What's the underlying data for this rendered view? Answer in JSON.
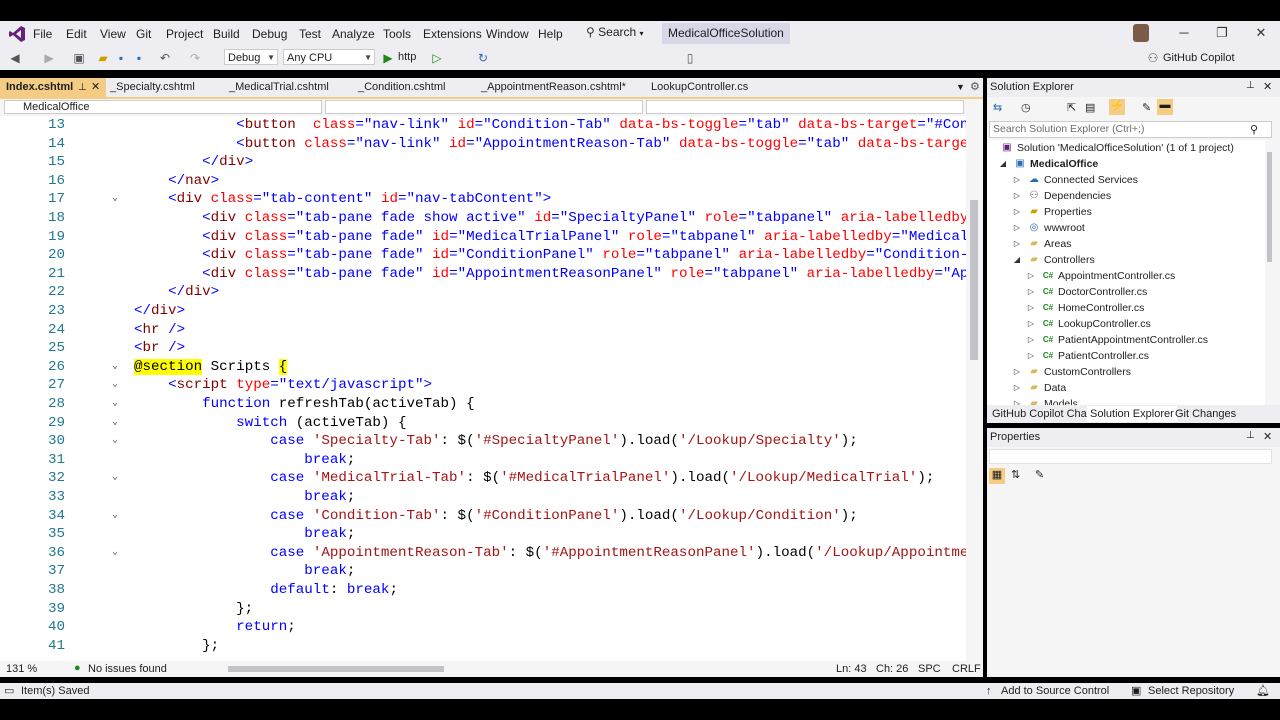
{
  "menu": [
    "File",
    "Edit",
    "View",
    "Git",
    "Project",
    "Build",
    "Debug",
    "Test",
    "Analyze",
    "Tools",
    "Extensions",
    "Window",
    "Help"
  ],
  "search_label": "Search",
  "solution_title": "MedicalOfficeSolution",
  "copilot_label": "GitHub Copilot",
  "toolbar": {
    "config": "Debug",
    "platform": "Any CPU",
    "run_target": "http"
  },
  "doc_tabs": [
    "Index.cshtml",
    "_Specialty.cshtml",
    "_MedicalTrial.cshtml",
    "_Condition.cshtml",
    "_AppointmentReason.cshtml*",
    "LookupController.cs"
  ],
  "nav_project": "MedicalOffice",
  "code_lines": [
    {
      "n": "13",
      "fold": "",
      "seg": [
        [
          "",
          "            "
        ],
        [
          "t-br",
          "<"
        ],
        [
          "t-tag",
          "button"
        ],
        [
          "",
          "  "
        ],
        [
          "t-attr",
          "class"
        ],
        [
          "t-br",
          "="
        ],
        [
          "t-val",
          "\"nav-link\""
        ],
        [
          "",
          " "
        ],
        [
          "t-attr",
          "id"
        ],
        [
          "t-br",
          "="
        ],
        [
          "t-val",
          "\"Condition-Tab\""
        ],
        [
          "",
          " "
        ],
        [
          "t-attr",
          "data-bs-toggle"
        ],
        [
          "t-br",
          "="
        ],
        [
          "t-val",
          "\"tab\""
        ],
        [
          "",
          " "
        ],
        [
          "t-attr",
          "data-bs-target"
        ],
        [
          "t-br",
          "="
        ],
        [
          "t-val",
          "\"#Condit"
        ]
      ]
    },
    {
      "n": "14",
      "fold": "",
      "seg": [
        [
          "",
          "            "
        ],
        [
          "t-br",
          "<"
        ],
        [
          "t-tag",
          "button"
        ],
        [
          "",
          " "
        ],
        [
          "t-attr",
          "class"
        ],
        [
          "t-br",
          "="
        ],
        [
          "t-val",
          "\"nav-link\""
        ],
        [
          "",
          " "
        ],
        [
          "t-attr",
          "id"
        ],
        [
          "t-br",
          "="
        ],
        [
          "t-val",
          "\"AppointmentReason-Tab\""
        ],
        [
          "",
          " "
        ],
        [
          "t-attr",
          "data-bs-toggle"
        ],
        [
          "t-br",
          "="
        ],
        [
          "t-val",
          "\"tab\""
        ],
        [
          "",
          " "
        ],
        [
          "t-attr",
          "data-bs-target"
        ],
        [
          "t-br",
          "="
        ]
      ]
    },
    {
      "n": "15",
      "fold": "",
      "seg": [
        [
          "",
          "        "
        ],
        [
          "t-br",
          "</"
        ],
        [
          "t-tag",
          "div"
        ],
        [
          "t-br",
          ">"
        ]
      ]
    },
    {
      "n": "16",
      "fold": "",
      "seg": [
        [
          "",
          "    "
        ],
        [
          "t-br",
          "</"
        ],
        [
          "t-tag",
          "nav"
        ],
        [
          "t-br",
          ">"
        ]
      ]
    },
    {
      "n": "17",
      "fold": "⌄",
      "seg": [
        [
          "",
          "    "
        ],
        [
          "t-br",
          "<"
        ],
        [
          "t-tag",
          "div"
        ],
        [
          "",
          " "
        ],
        [
          "t-attr",
          "class"
        ],
        [
          "t-br",
          "="
        ],
        [
          "t-val",
          "\"tab-content\""
        ],
        [
          "",
          " "
        ],
        [
          "t-attr",
          "id"
        ],
        [
          "t-br",
          "="
        ],
        [
          "t-val",
          "\"nav-tabContent\""
        ],
        [
          "t-br",
          ">"
        ]
      ]
    },
    {
      "n": "18",
      "fold": "",
      "seg": [
        [
          "",
          "        "
        ],
        [
          "t-br",
          "<"
        ],
        [
          "t-tag",
          "div"
        ],
        [
          "",
          " "
        ],
        [
          "t-attr",
          "class"
        ],
        [
          "t-br",
          "="
        ],
        [
          "t-val",
          "\"tab-pane fade show active\""
        ],
        [
          "",
          " "
        ],
        [
          "t-attr",
          "id"
        ],
        [
          "t-br",
          "="
        ],
        [
          "t-val",
          "\"SpecialtyPanel\""
        ],
        [
          "",
          " "
        ],
        [
          "t-attr",
          "role"
        ],
        [
          "t-br",
          "="
        ],
        [
          "t-val",
          "\"tabpanel\""
        ],
        [
          "",
          " "
        ],
        [
          "t-attr",
          "aria-labelledby"
        ],
        [
          "t-br",
          "="
        ],
        [
          "t-val",
          "\""
        ]
      ]
    },
    {
      "n": "19",
      "fold": "",
      "seg": [
        [
          "",
          "        "
        ],
        [
          "t-br",
          "<"
        ],
        [
          "t-tag",
          "div"
        ],
        [
          "",
          " "
        ],
        [
          "t-attr",
          "class"
        ],
        [
          "t-br",
          "="
        ],
        [
          "t-val",
          "\"tab-pane fade\""
        ],
        [
          "",
          " "
        ],
        [
          "t-attr",
          "id"
        ],
        [
          "t-br",
          "="
        ],
        [
          "t-val",
          "\"MedicalTrialPanel\""
        ],
        [
          "",
          " "
        ],
        [
          "t-attr",
          "role"
        ],
        [
          "t-br",
          "="
        ],
        [
          "t-val",
          "\"tabpanel\""
        ],
        [
          "",
          " "
        ],
        [
          "t-attr",
          "aria-labelledby"
        ],
        [
          "t-br",
          "="
        ],
        [
          "t-val",
          "\"MedicalTr"
        ]
      ]
    },
    {
      "n": "20",
      "fold": "",
      "seg": [
        [
          "",
          "        "
        ],
        [
          "t-br",
          "<"
        ],
        [
          "t-tag",
          "div"
        ],
        [
          "",
          " "
        ],
        [
          "t-attr",
          "class"
        ],
        [
          "t-br",
          "="
        ],
        [
          "t-val",
          "\"tab-pane fade\""
        ],
        [
          "",
          " "
        ],
        [
          "t-attr",
          "id"
        ],
        [
          "t-br",
          "="
        ],
        [
          "t-val",
          "\"ConditionPanel\""
        ],
        [
          "",
          " "
        ],
        [
          "t-attr",
          "role"
        ],
        [
          "t-br",
          "="
        ],
        [
          "t-val",
          "\"tabpanel\""
        ],
        [
          "",
          " "
        ],
        [
          "t-attr",
          "aria-labelledby"
        ],
        [
          "t-br",
          "="
        ],
        [
          "t-val",
          "\"Condition-Ta"
        ]
      ]
    },
    {
      "n": "21",
      "fold": "",
      "seg": [
        [
          "",
          "        "
        ],
        [
          "t-br",
          "<"
        ],
        [
          "t-tag",
          "div"
        ],
        [
          "",
          " "
        ],
        [
          "t-attr",
          "class"
        ],
        [
          "t-br",
          "="
        ],
        [
          "t-val",
          "\"tab-pane fade\""
        ],
        [
          "",
          " "
        ],
        [
          "t-attr",
          "id"
        ],
        [
          "t-br",
          "="
        ],
        [
          "t-val",
          "\"AppointmentReasonPanel\""
        ],
        [
          "",
          " "
        ],
        [
          "t-attr",
          "role"
        ],
        [
          "t-br",
          "="
        ],
        [
          "t-val",
          "\"tabpanel\""
        ],
        [
          "",
          " "
        ],
        [
          "t-attr",
          "aria-labelledby"
        ],
        [
          "t-br",
          "="
        ],
        [
          "t-val",
          "\"Appo"
        ]
      ]
    },
    {
      "n": "22",
      "fold": "",
      "seg": [
        [
          "",
          "    "
        ],
        [
          "t-br",
          "</"
        ],
        [
          "t-tag",
          "div"
        ],
        [
          "t-br",
          ">"
        ]
      ]
    },
    {
      "n": "23",
      "fold": "",
      "seg": [
        [
          "t-br",
          "</"
        ],
        [
          "t-tag",
          "div"
        ],
        [
          "t-br",
          ">"
        ]
      ]
    },
    {
      "n": "24",
      "fold": "",
      "seg": [
        [
          "t-br",
          "<"
        ],
        [
          "t-tag",
          "hr"
        ],
        [
          "",
          " "
        ],
        [
          "t-br",
          "/>"
        ]
      ]
    },
    {
      "n": "25",
      "fold": "",
      "seg": [
        [
          "t-br",
          "<"
        ],
        [
          "t-tag",
          "br"
        ],
        [
          "",
          " "
        ],
        [
          "t-br",
          "/>"
        ]
      ]
    },
    {
      "n": "26",
      "fold": "⌄",
      "seg": [
        [
          "t-raz",
          "@section"
        ],
        [
          "t-plain",
          " Scripts "
        ],
        [
          "t-raz",
          "{"
        ]
      ]
    },
    {
      "n": "27",
      "fold": "⌄",
      "seg": [
        [
          "",
          "    "
        ],
        [
          "t-br",
          "<"
        ],
        [
          "t-tag",
          "script"
        ],
        [
          "",
          " "
        ],
        [
          "t-attr",
          "type"
        ],
        [
          "t-br",
          "="
        ],
        [
          "t-val",
          "\"text/javascript\""
        ],
        [
          "t-br",
          ">"
        ]
      ]
    },
    {
      "n": "28",
      "fold": "⌄",
      "seg": [
        [
          "",
          "        "
        ],
        [
          "t-kw",
          "function"
        ],
        [
          "t-plain",
          " refreshTab(activeTab) {"
        ]
      ]
    },
    {
      "n": "29",
      "fold": "⌄",
      "seg": [
        [
          "",
          "            "
        ],
        [
          "t-kw",
          "switch"
        ],
        [
          "t-plain",
          " (activeTab) {"
        ]
      ]
    },
    {
      "n": "30",
      "fold": "⌄",
      "seg": [
        [
          "",
          "                "
        ],
        [
          "t-kw",
          "case"
        ],
        [
          "",
          " "
        ],
        [
          "t-str",
          "'Specialty-Tab'"
        ],
        [
          "t-plain",
          ": $("
        ],
        [
          "t-str",
          "'#SpecialtyPanel'"
        ],
        [
          "t-plain",
          ").load("
        ],
        [
          "t-str",
          "'/Lookup/Specialty'"
        ],
        [
          "t-plain",
          ");"
        ]
      ]
    },
    {
      "n": "31",
      "fold": "",
      "seg": [
        [
          "",
          "                    "
        ],
        [
          "t-kw",
          "break"
        ],
        [
          "t-plain",
          ";"
        ]
      ]
    },
    {
      "n": "32",
      "fold": "⌄",
      "seg": [
        [
          "",
          "                "
        ],
        [
          "t-kw",
          "case"
        ],
        [
          "",
          " "
        ],
        [
          "t-str",
          "'MedicalTrial-Tab'"
        ],
        [
          "t-plain",
          ": $("
        ],
        [
          "t-str",
          "'#MedicalTrialPanel'"
        ],
        [
          "t-plain",
          ").load("
        ],
        [
          "t-str",
          "'/Lookup/MedicalTrial'"
        ],
        [
          "t-plain",
          ");"
        ]
      ]
    },
    {
      "n": "33",
      "fold": "",
      "seg": [
        [
          "",
          "                    "
        ],
        [
          "t-kw",
          "break"
        ],
        [
          "t-plain",
          ";"
        ]
      ]
    },
    {
      "n": "34",
      "fold": "⌄",
      "seg": [
        [
          "",
          "                "
        ],
        [
          "t-kw",
          "case"
        ],
        [
          "",
          " "
        ],
        [
          "t-str",
          "'Condition-Tab'"
        ],
        [
          "t-plain",
          ": $("
        ],
        [
          "t-str",
          "'#ConditionPanel'"
        ],
        [
          "t-plain",
          ").load("
        ],
        [
          "t-str",
          "'/Lookup/Condition'"
        ],
        [
          "t-plain",
          ");"
        ]
      ]
    },
    {
      "n": "35",
      "fold": "",
      "seg": [
        [
          "",
          "                    "
        ],
        [
          "t-kw",
          "break"
        ],
        [
          "t-plain",
          ";"
        ]
      ]
    },
    {
      "n": "36",
      "fold": "⌄",
      "seg": [
        [
          "",
          "                "
        ],
        [
          "t-kw",
          "case"
        ],
        [
          "",
          " "
        ],
        [
          "t-str",
          "'AppointmentReason-Tab'"
        ],
        [
          "t-plain",
          ": $("
        ],
        [
          "t-str",
          "'#AppointmentReasonPanel'"
        ],
        [
          "t-plain",
          ").load("
        ],
        [
          "t-str",
          "'/Lookup/Appointment"
        ]
      ]
    },
    {
      "n": "37",
      "fold": "",
      "seg": [
        [
          "",
          "                    "
        ],
        [
          "t-kw",
          "break"
        ],
        [
          "t-plain",
          ";"
        ]
      ]
    },
    {
      "n": "38",
      "fold": "",
      "seg": [
        [
          "",
          "                "
        ],
        [
          "t-kw",
          "default"
        ],
        [
          "t-plain",
          ": "
        ],
        [
          "t-kw",
          "break"
        ],
        [
          "t-plain",
          ";"
        ]
      ]
    },
    {
      "n": "39",
      "fold": "",
      "seg": [
        [
          "",
          "            "
        ],
        [
          "t-plain",
          "};"
        ]
      ]
    },
    {
      "n": "40",
      "fold": "",
      "seg": [
        [
          "",
          "            "
        ],
        [
          "t-kw",
          "return"
        ],
        [
          "t-plain",
          ";"
        ]
      ]
    },
    {
      "n": "41",
      "fold": "",
      "seg": [
        [
          "",
          "        "
        ],
        [
          "t-plain",
          "};"
        ]
      ]
    }
  ],
  "editor_status": {
    "zoom": "131 %",
    "issues": "No issues found",
    "ln": "Ln: 43",
    "ch": "Ch: 26",
    "spc": "SPC",
    "crlf": "CRLF"
  },
  "solution_explorer": {
    "title": "Solution Explorer",
    "search_placeholder": "Search Solution Explorer (Ctrl+;)",
    "nodes": [
      {
        "label": "Solution 'MedicalOfficeSolution' (1 of 1 project)",
        "level": 0,
        "icon": "solution-icon",
        "tw": ""
      },
      {
        "label": "MedicalOffice",
        "level": 1,
        "icon": "project-icon",
        "tw": "◢",
        "bold": true
      },
      {
        "label": "Connected Services",
        "level": 2,
        "icon": "connected-services-icon",
        "tw": "▷"
      },
      {
        "label": "Dependencies",
        "level": 2,
        "icon": "dependencies-icon",
        "tw": "▷"
      },
      {
        "label": "Properties",
        "level": 2,
        "icon": "properties-folder-icon",
        "tw": "▷"
      },
      {
        "label": "wwwroot",
        "level": 2,
        "icon": "globe-icon",
        "tw": "▷"
      },
      {
        "label": "Areas",
        "level": 2,
        "icon": "folder-icon",
        "tw": "▷"
      },
      {
        "label": "Controllers",
        "level": 2,
        "icon": "folder-open-icon",
        "tw": "◢"
      },
      {
        "label": "AppointmentController.cs",
        "level": 3,
        "icon": "csharp-file-icon",
        "tw": "▷"
      },
      {
        "label": "DoctorController.cs",
        "level": 3,
        "icon": "csharp-file-icon",
        "tw": "▷"
      },
      {
        "label": "HomeController.cs",
        "level": 3,
        "icon": "csharp-file-icon",
        "tw": "▷"
      },
      {
        "label": "LookupController.cs",
        "level": 3,
        "icon": "csharp-file-icon",
        "tw": "▷"
      },
      {
        "label": "PatientAppointmentController.cs",
        "level": 3,
        "icon": "csharp-file-icon",
        "tw": "▷"
      },
      {
        "label": "PatientController.cs",
        "level": 3,
        "icon": "csharp-file-icon",
        "tw": "▷"
      },
      {
        "label": "CustomControllers",
        "level": 2,
        "icon": "folder-icon",
        "tw": "▷"
      },
      {
        "label": "Data",
        "level": 2,
        "icon": "folder-icon",
        "tw": "▷"
      },
      {
        "label": "Models",
        "level": 2,
        "icon": "folder-icon",
        "tw": "▷"
      }
    ],
    "tabs": [
      "GitHub Copilot Chat",
      "Solution Explorer",
      "Git Changes"
    ]
  },
  "properties_title": "Properties",
  "status": {
    "saved": "Item(s) Saved",
    "source_control": "Add to Source Control",
    "repo": "Select Repository"
  },
  "colors": {
    "accent": "#f5cc84",
    "vs_purple": "#68217a",
    "chrome": "#eeeef2"
  }
}
